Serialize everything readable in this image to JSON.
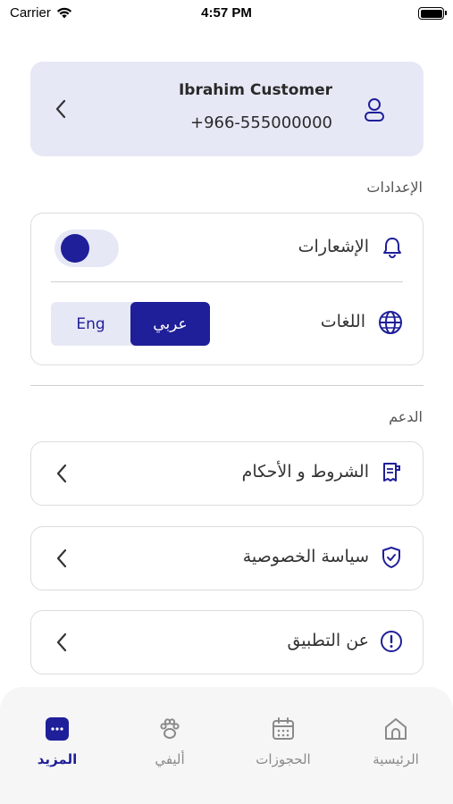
{
  "status_bar": {
    "carrier": "Carrier",
    "time": "4:57 PM"
  },
  "profile": {
    "name": "Ibrahim Customer",
    "phone": "+966-555000000"
  },
  "settings": {
    "title": "الإعدادات",
    "notifications_label": "الإشعارات",
    "notifications_on": true,
    "languages_label": "اللغات",
    "lang_eng": "Eng",
    "lang_ar": "عربي",
    "lang_selected": "عربي"
  },
  "support": {
    "title": "الدعم",
    "items": [
      {
        "label": "الشروط و الأحكام",
        "icon": "document-icon"
      },
      {
        "label": "سياسة الخصوصية",
        "icon": "shield-icon"
      },
      {
        "label": "عن التطبيق",
        "icon": "info-icon"
      }
    ]
  },
  "tabs": [
    {
      "label": "الرئيسية",
      "icon": "home-icon",
      "active": false
    },
    {
      "label": "الحجوزات",
      "icon": "calendar-icon",
      "active": false
    },
    {
      "label": "أليفي",
      "icon": "paw-icon",
      "active": false
    },
    {
      "label": "المزيد",
      "icon": "more-icon",
      "active": true
    }
  ],
  "colors": {
    "accent": "#1f1f99",
    "card_bg": "#e7e8f6",
    "tab_bar_bg": "#f6f6f6"
  }
}
